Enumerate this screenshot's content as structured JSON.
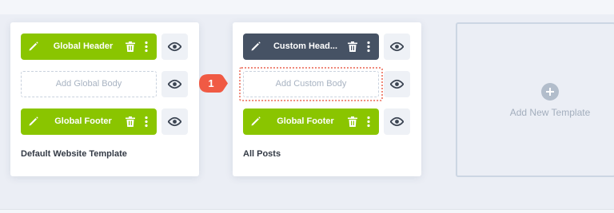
{
  "templates": [
    {
      "title": "Default Website Template",
      "header": {
        "label": "Global Header"
      },
      "body": {
        "placeholder": "Add Global Body"
      },
      "footer": {
        "label": "Global Footer"
      }
    },
    {
      "title": "All Posts",
      "header": {
        "label": "Custom Head..."
      },
      "body": {
        "placeholder": "Add Custom Body"
      },
      "footer": {
        "label": "Global Footer"
      }
    }
  ],
  "add_template": {
    "label": "Add New Template",
    "icon": "plus-icon"
  },
  "step_marker": {
    "number": "1"
  },
  "icons": {
    "edit": "pencil-icon",
    "delete": "trash-icon",
    "more": "more-vertical-icon",
    "visibility": "eye-icon"
  },
  "colors": {
    "global_area": "#8ac500",
    "custom_area": "#465264",
    "step_marker": "#f05a44",
    "highlight": "#ef8a7b"
  }
}
